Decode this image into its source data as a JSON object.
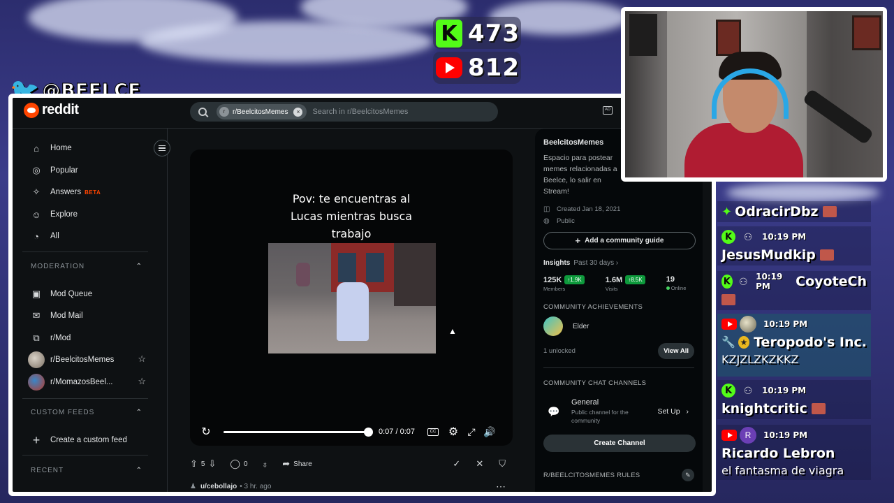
{
  "overlay": {
    "kick_count": "473",
    "youtube_count": "812",
    "twitter_handle": "@BEELCE_",
    "kick_letter": "K"
  },
  "reddit": {
    "logo_text": "reddit",
    "search": {
      "community_chip": "r/BeelcitosMemes",
      "placeholder": "Search in r/BeelcitosMemes"
    },
    "sidebar": {
      "nav": [
        {
          "label": "Home",
          "icon": "home-icon"
        },
        {
          "label": "Popular",
          "icon": "popular-icon"
        },
        {
          "label": "Answers",
          "icon": "answers-icon",
          "badge": "BETA"
        },
        {
          "label": "Explore",
          "icon": "explore-icon"
        },
        {
          "label": "All",
          "icon": "all-icon"
        }
      ],
      "moderation_header": "MODERATION",
      "moderation": [
        {
          "label": "Mod Queue",
          "icon": "mod-queue-icon"
        },
        {
          "label": "Mod Mail",
          "icon": "mod-mail-icon"
        },
        {
          "label": "r/Mod",
          "icon": "mod-icon"
        },
        {
          "label": "r/BeelcitosMemes",
          "icon": "community-avatar"
        },
        {
          "label": "r/MomazosBeel...",
          "icon": "community-avatar"
        }
      ],
      "custom_feeds_header": "CUSTOM FEEDS",
      "create_feed": "Create a custom feed",
      "recent_header": "RECENT"
    },
    "post": {
      "caption_line1": "Pov: te encuentras al",
      "caption_line2": "Lucas mientras busca",
      "caption_line3": "trabajo",
      "time": "0:07 / 0:07",
      "playback_progress_percent": 100,
      "votes": "5",
      "comments": "0",
      "share": "Share",
      "next_author": "u/cebollajo",
      "next_time": "• 3 hr. ago",
      "cc_label": "CC"
    },
    "community": {
      "name": "BeelcitosMemes",
      "description": "Espacio para postear memes relacionadas a Beelce, lo salir en Stream!",
      "created": "Created Jan 18, 2021",
      "visibility": "Public",
      "guide_button": "Add a community guide",
      "insights_label": "Insights",
      "insights_period": "Past 30 days ›",
      "stats": [
        {
          "value": "125K",
          "delta": "↑1.9K",
          "label": "Members"
        },
        {
          "value": "1.6M",
          "delta": "↑8.5K",
          "label": "Visits"
        },
        {
          "value": "19",
          "delta": "",
          "label": "Online"
        }
      ],
      "achievements_header": "COMMUNITY ACHIEVEMENTS",
      "achievement_name": "Elder",
      "unlocked": "1 unlocked",
      "view_all": "View All",
      "chat_header": "COMMUNITY CHAT CHANNELS",
      "channel_name": "General",
      "channel_desc": "Public channel for the community",
      "setup": "Set Up",
      "create_channel": "Create Channel",
      "rules_header": "R/BEELCITOSMEMES RULES"
    }
  },
  "chat": [
    {
      "platform": "kick",
      "time": "",
      "user": "OdracirDbz",
      "text": ""
    },
    {
      "platform": "kick",
      "time": "10:19 PM",
      "user": "JesusMudkip",
      "text": ""
    },
    {
      "platform": "kick",
      "time": "10:19 PM",
      "user": "CoyoteCh",
      "text": ""
    },
    {
      "platform": "youtube",
      "time": "10:19 PM",
      "user": "Teropodo's Inc.",
      "text": "KZJZLZKZKKZ"
    },
    {
      "platform": "kick",
      "time": "10:19 PM",
      "user": "knightcritic",
      "text": ""
    },
    {
      "platform": "youtube",
      "time": "10:19 PM",
      "user": "Ricardo Lebron",
      "text": "el fantasma de viagra",
      "avatar_letter": "R"
    }
  ]
}
